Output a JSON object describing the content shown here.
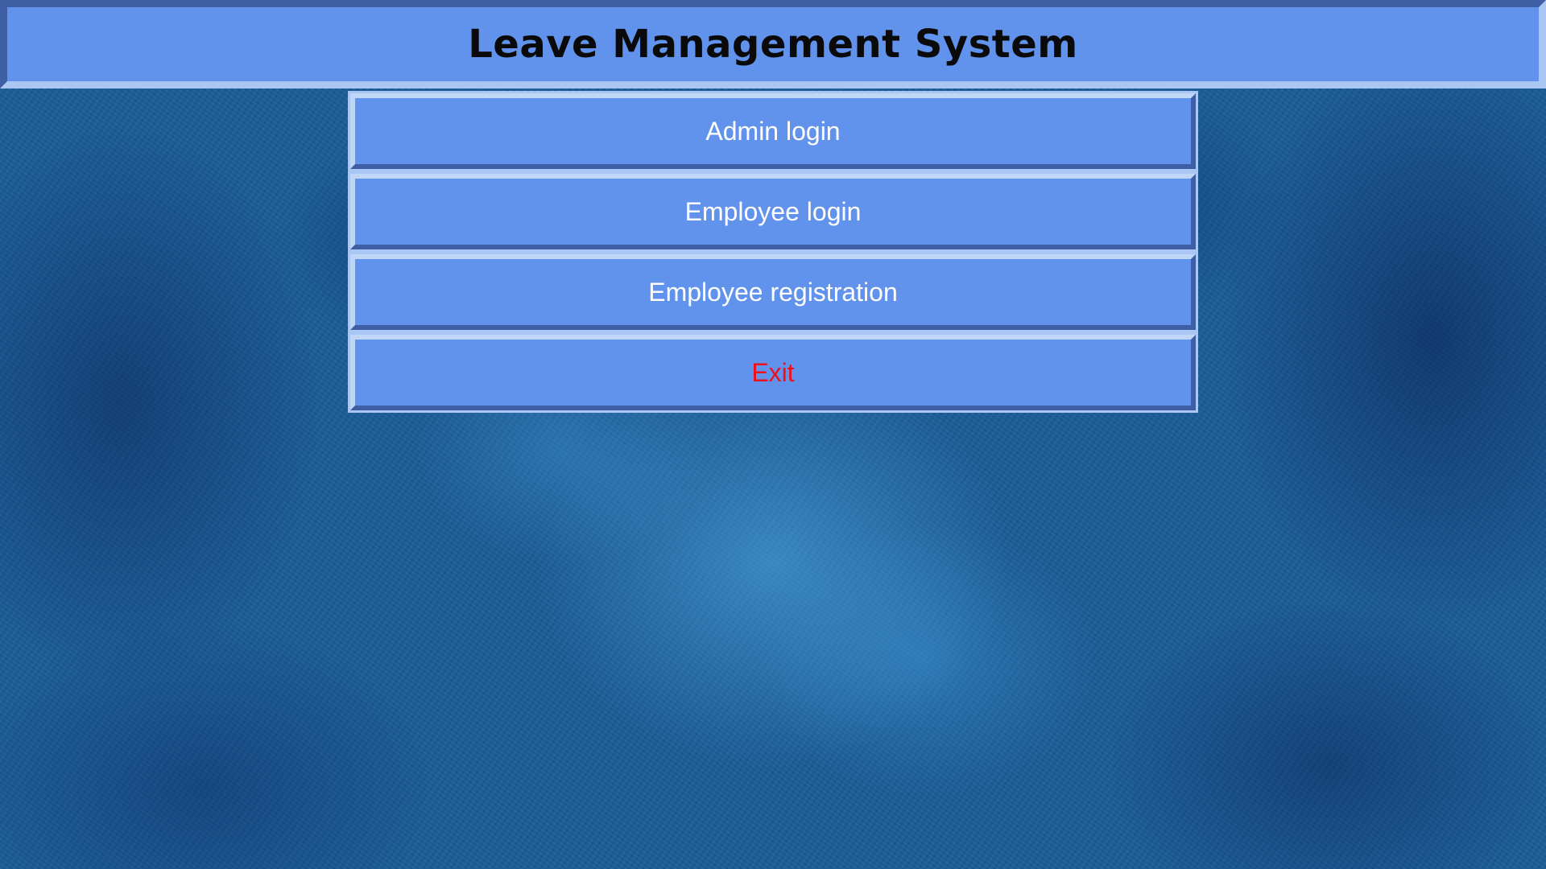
{
  "header": {
    "title": "Leave Management System"
  },
  "menu": {
    "items": [
      {
        "label": "Admin login"
      },
      {
        "label": "Employee login"
      },
      {
        "label": "Employee registration"
      },
      {
        "label": "Exit"
      }
    ]
  },
  "colors": {
    "panel": "#6192ec",
    "exit_text": "#f0101a",
    "button_text": "#ffffff",
    "title_text": "#0a0a0a"
  }
}
